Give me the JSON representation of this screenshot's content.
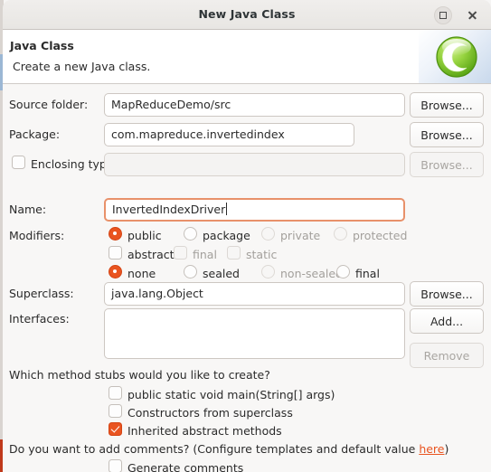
{
  "window": {
    "title": "New Java Class",
    "controls": {
      "maximize": "maximize-icon",
      "close": "close-icon"
    }
  },
  "header": {
    "title": "Java Class",
    "subtitle": "Create a new Java class.",
    "icon": "java-class-icon"
  },
  "fields": {
    "source_folder": {
      "label": "Source folder:",
      "value": "MapReduceDemo/src",
      "button": "Browse..."
    },
    "package": {
      "label": "Package:",
      "value": "com.mapreduce.invertedindex",
      "button": "Browse..."
    },
    "enclosing_type": {
      "label": "Enclosing type:",
      "value": "",
      "checked": false,
      "button": "Browse...",
      "enabled": false
    },
    "name": {
      "label": "Name:",
      "value": "InvertedIndexDriver",
      "focused": true
    },
    "superclass": {
      "label": "Superclass:",
      "value": "java.lang.Object",
      "button": "Browse..."
    },
    "interfaces": {
      "label": "Interfaces:",
      "value": "",
      "add_button": "Add...",
      "remove_button": "Remove",
      "remove_enabled": false
    }
  },
  "modifiers": {
    "label": "Modifiers:",
    "access": [
      {
        "label": "public",
        "selected": true,
        "enabled": true
      },
      {
        "label": "package",
        "selected": false,
        "enabled": true
      },
      {
        "label": "private",
        "selected": false,
        "enabled": false
      },
      {
        "label": "protected",
        "selected": false,
        "enabled": false
      }
    ],
    "flags": [
      {
        "label": "abstract",
        "checked": false,
        "enabled": true
      },
      {
        "label": "final",
        "checked": false,
        "enabled": false
      },
      {
        "label": "static",
        "checked": false,
        "enabled": false
      }
    ],
    "sealed": [
      {
        "label": "none",
        "selected": true,
        "enabled": true
      },
      {
        "label": "sealed",
        "selected": false,
        "enabled": true
      },
      {
        "label": "non-sealed",
        "selected": false,
        "enabled": false
      },
      {
        "label": "final",
        "selected": false,
        "enabled": true
      }
    ]
  },
  "stubs": {
    "question": "Which method stubs would you like to create?",
    "options": [
      {
        "label": "public static void main(String[] args)",
        "checked": false
      },
      {
        "label": "Constructors from superclass",
        "checked": false
      },
      {
        "label": "Inherited abstract methods",
        "checked": true
      }
    ]
  },
  "comments": {
    "question_prefix": "Do you want to add comments? (Configure templates and default value ",
    "link": "here",
    "question_suffix": ")",
    "option": {
      "label": "Generate comments",
      "checked": false
    }
  },
  "colors": {
    "accent": "#e95420",
    "focus_border": "#e8916a",
    "text": "#2b2b2b",
    "disabled_text": "#a3a09c",
    "body_bg": "#f8f7f6"
  }
}
